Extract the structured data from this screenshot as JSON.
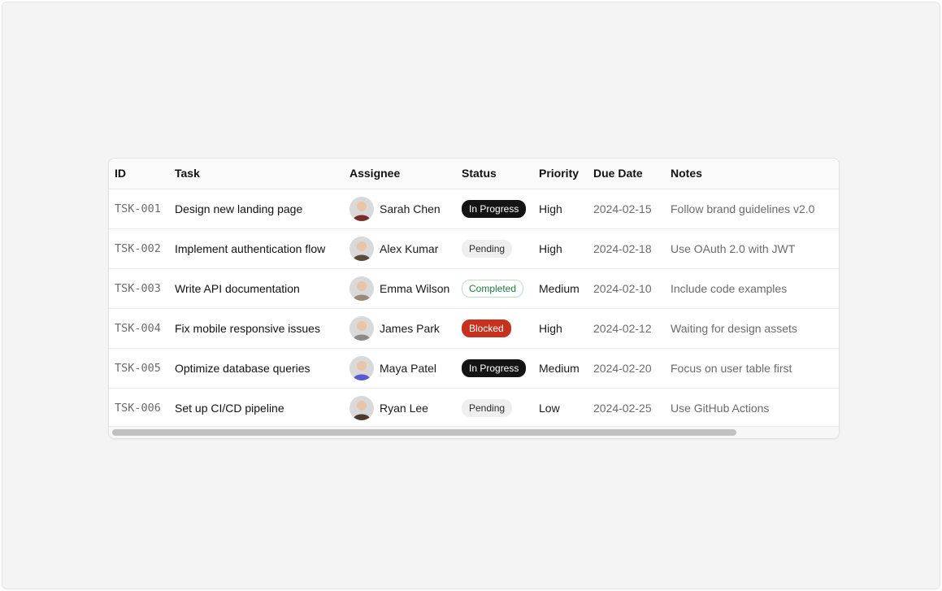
{
  "columns": {
    "id": "ID",
    "task": "Task",
    "assignee": "Assignee",
    "status": "Status",
    "priority": "Priority",
    "due_date": "Due Date",
    "notes": "Notes"
  },
  "status_colors": {
    "In Progress": {
      "bg": "#141414",
      "fg": "#ffffff",
      "border": "#141414"
    },
    "Pending": {
      "bg": "#efefef",
      "fg": "#2a2a2a",
      "border": "#efefef"
    },
    "Completed": {
      "bg": "#ffffff",
      "fg": "#1f7a3a",
      "border": "#b9dfc4"
    },
    "Blocked": {
      "bg": "#c73220",
      "fg": "#ffffff",
      "border": "#c73220"
    }
  },
  "rows": [
    {
      "id": "TSK-001",
      "task": "Design new landing page",
      "assignee": "Sarah Chen",
      "avatar": "avatar-sarah-chen",
      "avatar_color": "#7a2b2b",
      "status": "In Progress",
      "priority": "High",
      "due_date": "2024-02-15",
      "notes": "Follow brand guidelines v2.0"
    },
    {
      "id": "TSK-002",
      "task": "Implement authentication flow",
      "assignee": "Alex Kumar",
      "avatar": "avatar-alex-kumar",
      "avatar_color": "#5a4a3a",
      "status": "Pending",
      "priority": "High",
      "due_date": "2024-02-18",
      "notes": "Use OAuth 2.0 with JWT"
    },
    {
      "id": "TSK-003",
      "task": "Write API documentation",
      "assignee": "Emma Wilson",
      "avatar": "avatar-emma-wilson",
      "avatar_color": "#9a8a7a",
      "status": "Completed",
      "priority": "Medium",
      "due_date": "2024-02-10",
      "notes": "Include code examples"
    },
    {
      "id": "TSK-004",
      "task": "Fix mobile responsive issues",
      "assignee": "James Park",
      "avatar": "avatar-james-park",
      "avatar_color": "#8a8a8a",
      "status": "Blocked",
      "priority": "High",
      "due_date": "2024-02-12",
      "notes": "Waiting for design assets"
    },
    {
      "id": "TSK-005",
      "task": "Optimize database queries",
      "assignee": "Maya Patel",
      "avatar": "avatar-maya-patel",
      "avatar_color": "#5a5ad0",
      "status": "In Progress",
      "priority": "Medium",
      "due_date": "2024-02-20",
      "notes": "Focus on user table first"
    },
    {
      "id": "TSK-006",
      "task": "Set up CI/CD pipeline",
      "assignee": "Ryan Lee",
      "avatar": "avatar-ryan-lee",
      "avatar_color": "#4a3a30",
      "status": "Pending",
      "priority": "Low",
      "due_date": "2024-02-25",
      "notes": "Use GitHub Actions"
    }
  ]
}
